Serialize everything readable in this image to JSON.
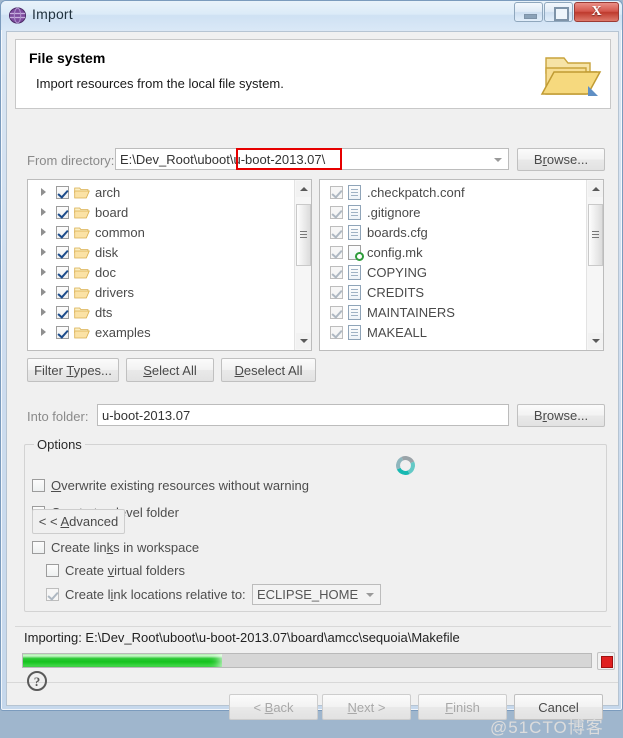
{
  "window": {
    "title": "Import",
    "icon": "eclipse-sphere-icon",
    "controls": {
      "minimize": "minimize-icon",
      "maximize": "maximize-icon",
      "close": "X"
    }
  },
  "banner": {
    "title": "File system",
    "subtitle": "Import resources from the local file system.",
    "icon": "open-folder-icon"
  },
  "from_directory": {
    "label": "From directory:",
    "value": "E:\\Dev_Root\\uboot\\u-boot-2013.07\\",
    "highlight_text": "u-boot-2013.07\\",
    "highlight_color": "#e60000",
    "browse_label": "Browse..."
  },
  "tree": {
    "items": [
      {
        "label": "arch",
        "checked": true,
        "expandable": true
      },
      {
        "label": "board",
        "checked": true,
        "expandable": true
      },
      {
        "label": "common",
        "checked": true,
        "expandable": true
      },
      {
        "label": "disk",
        "checked": true,
        "expandable": true
      },
      {
        "label": "doc",
        "checked": true,
        "expandable": true
      },
      {
        "label": "drivers",
        "checked": true,
        "expandable": true
      },
      {
        "label": "dts",
        "checked": true,
        "expandable": true
      },
      {
        "label": "examples",
        "checked": true,
        "expandable": true
      }
    ]
  },
  "files": {
    "items": [
      {
        "label": ".checkpatch.conf",
        "checked": true,
        "icon": "file-icon"
      },
      {
        "label": ".gitignore",
        "checked": true,
        "icon": "file-icon"
      },
      {
        "label": "boards.cfg",
        "checked": true,
        "icon": "file-icon"
      },
      {
        "label": "config.mk",
        "checked": true,
        "icon": "makefile-icon"
      },
      {
        "label": "COPYING",
        "checked": true,
        "icon": "file-icon"
      },
      {
        "label": "CREDITS",
        "checked": true,
        "icon": "file-icon"
      },
      {
        "label": "MAINTAINERS",
        "checked": true,
        "icon": "file-icon"
      },
      {
        "label": "MAKEALL",
        "checked": true,
        "icon": "file-icon"
      }
    ]
  },
  "selection_buttons": {
    "filter_types": "Filter Types...",
    "select_all": "Select All",
    "deselect_all": "Deselect All"
  },
  "into_folder": {
    "label": "Into folder:",
    "value": "u-boot-2013.07",
    "browse_label": "Browse..."
  },
  "options": {
    "title": "Options",
    "overwrite": {
      "label": "Overwrite existing resources without warning",
      "checked": false
    },
    "top_level": {
      "label": "Create top-level folder",
      "checked": false
    },
    "advanced_button": "< < Advanced",
    "links_workspace": {
      "label": "Create links in workspace",
      "checked": false
    },
    "virtual_folders": {
      "label": "Create virtual folders",
      "checked": false
    },
    "link_relative": {
      "label": "Create link locations relative to:",
      "checked": true
    },
    "relative_value": "ECLIPSE_HOME",
    "spinner": "loading-spinner-icon"
  },
  "progress": {
    "status": "Importing: E:\\Dev_Root\\uboot\\u-boot-2013.07\\board\\amcc\\sequoia\\Makefile",
    "percent": 35,
    "bar_color": "#1dbf25",
    "stop_label": "stop-icon"
  },
  "footer": {
    "help": "?",
    "back": "< Back",
    "next": "Next >",
    "finish": "Finish",
    "cancel": "Cancel"
  },
  "watermark": "@51CTO博客"
}
